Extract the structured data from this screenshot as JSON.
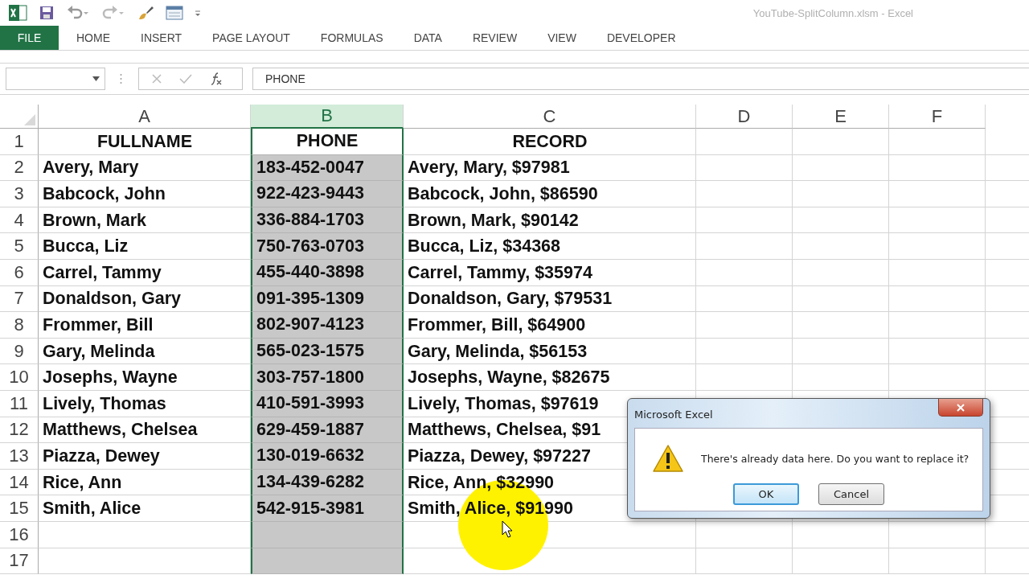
{
  "window": {
    "title": "YouTube-SplitColumn.xlsm - Excel"
  },
  "ribbon_tabs": [
    {
      "label": "FILE",
      "kind": "file"
    },
    {
      "label": "HOME",
      "kind": "tab"
    },
    {
      "label": "INSERT",
      "kind": "tab"
    },
    {
      "label": "PAGE LAYOUT",
      "kind": "tab"
    },
    {
      "label": "FORMULAS",
      "kind": "tab"
    },
    {
      "label": "DATA",
      "kind": "tab"
    },
    {
      "label": "REVIEW",
      "kind": "tab"
    },
    {
      "label": "VIEW",
      "kind": "tab"
    },
    {
      "label": "DEVELOPER",
      "kind": "tab"
    }
  ],
  "formula_bar": {
    "value": "PHONE"
  },
  "sheet": {
    "columns": [
      {
        "label": "A",
        "selected": false
      },
      {
        "label": "B",
        "selected": true
      },
      {
        "label": "C",
        "selected": false
      },
      {
        "label": "D",
        "selected": false
      },
      {
        "label": "E",
        "selected": false
      },
      {
        "label": "F",
        "selected": false
      }
    ],
    "rows": [
      {
        "number": "1",
        "kind": "header",
        "active": true,
        "cells": [
          "FULLNAME",
          "PHONE",
          "RECORD"
        ]
      },
      {
        "number": "2",
        "kind": "data",
        "active": false,
        "cells": [
          "Avery, Mary",
          "183-452-0047",
          "Avery, Mary, $97981"
        ]
      },
      {
        "number": "3",
        "kind": "data",
        "active": false,
        "cells": [
          "Babcock, John",
          "922-423-9443",
          "Babcock, John, $86590"
        ]
      },
      {
        "number": "4",
        "kind": "data",
        "active": false,
        "cells": [
          "Brown, Mark",
          "336-884-1703",
          "Brown, Mark, $90142"
        ]
      },
      {
        "number": "5",
        "kind": "data",
        "active": false,
        "cells": [
          "Bucca, Liz",
          "750-763-0703",
          "Bucca, Liz, $34368"
        ]
      },
      {
        "number": "6",
        "kind": "data",
        "active": false,
        "cells": [
          "Carrel, Tammy",
          "455-440-3898",
          "Carrel, Tammy, $35974"
        ]
      },
      {
        "number": "7",
        "kind": "data",
        "active": false,
        "cells": [
          "Donaldson, Gary",
          "091-395-1309",
          "Donaldson, Gary, $79531"
        ]
      },
      {
        "number": "8",
        "kind": "data",
        "active": false,
        "cells": [
          "Frommer, Bill",
          "802-907-4123",
          "Frommer, Bill, $64900"
        ]
      },
      {
        "number": "9",
        "kind": "data",
        "active": false,
        "cells": [
          "Gary, Melinda",
          "565-023-1575",
          "Gary, Melinda, $56153"
        ]
      },
      {
        "number": "10",
        "kind": "data",
        "active": false,
        "cells": [
          "Josephs, Wayne",
          "303-757-1800",
          "Josephs, Wayne, $82675"
        ]
      },
      {
        "number": "11",
        "kind": "data",
        "active": false,
        "cells": [
          "Lively, Thomas",
          "410-591-3993",
          "Lively, Thomas, $97619"
        ]
      },
      {
        "number": "12",
        "kind": "data",
        "active": false,
        "cells": [
          "Matthews, Chelsea",
          "629-459-1887",
          "Matthews, Chelsea, $91"
        ]
      },
      {
        "number": "13",
        "kind": "data",
        "active": false,
        "cells": [
          "Piazza, Dewey",
          "130-019-6632",
          "Piazza, Dewey, $97227"
        ]
      },
      {
        "number": "14",
        "kind": "data",
        "active": false,
        "cells": [
          "Rice, Ann",
          "134-439-6282",
          "Rice, Ann, $32990"
        ]
      },
      {
        "number": "15",
        "kind": "data",
        "active": false,
        "cells": [
          "Smith, Alice",
          "542-915-3981",
          "Smith, Alice, $91990"
        ]
      },
      {
        "number": "16",
        "kind": "data",
        "active": false
      },
      {
        "number": "17",
        "kind": "data",
        "active": false
      }
    ]
  },
  "dialog": {
    "title": "Microsoft Excel",
    "message": "There's already data here. Do you want to replace it?",
    "buttons": [
      {
        "label": "OK",
        "selected": true
      },
      {
        "label": "Cancel",
        "selected": false
      }
    ]
  }
}
